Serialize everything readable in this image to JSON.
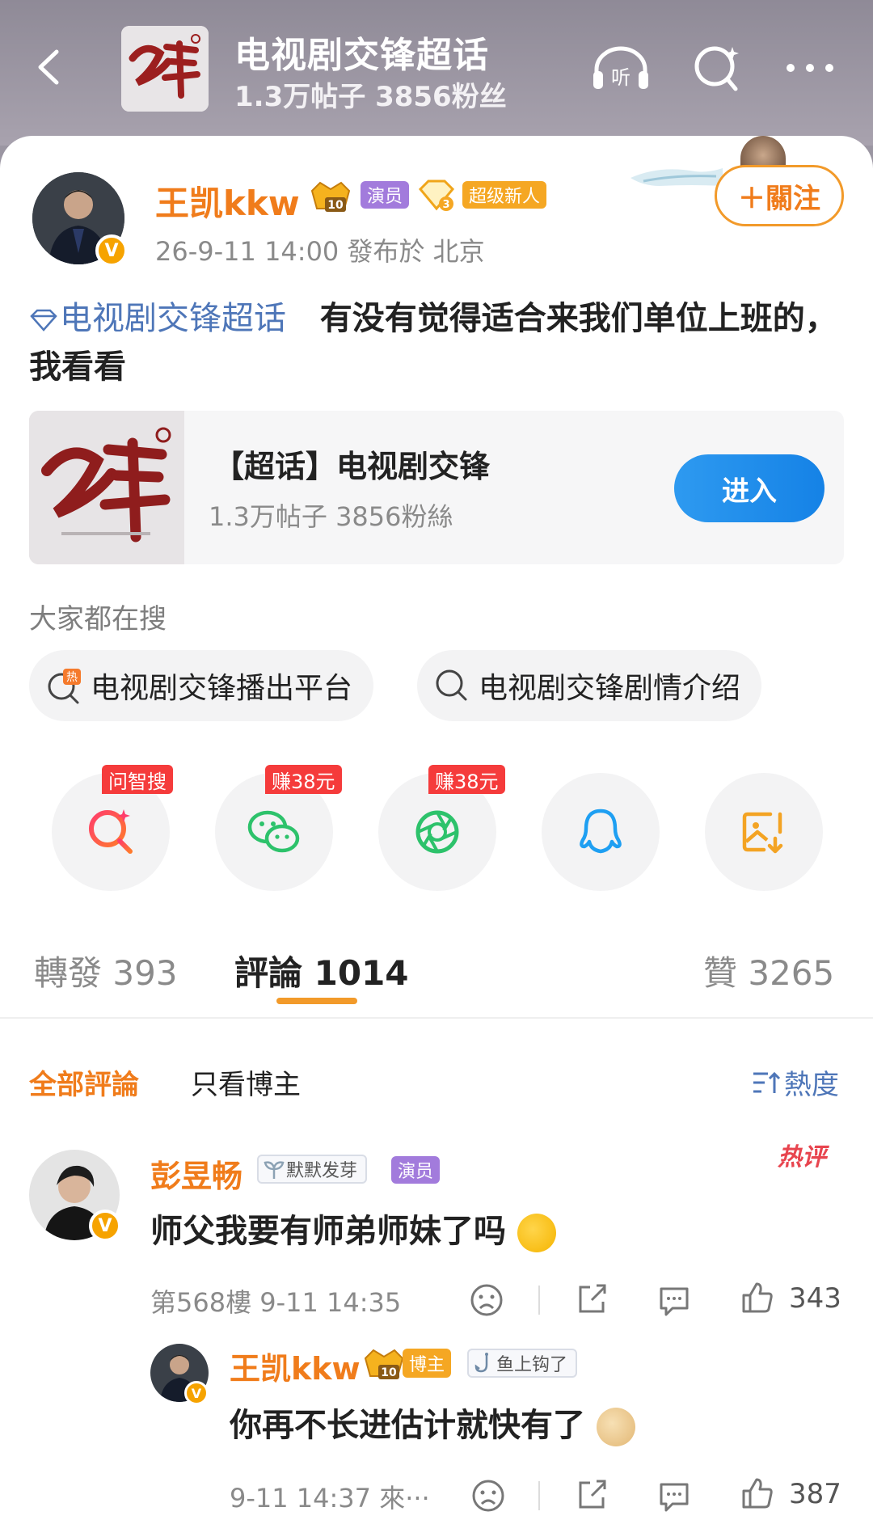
{
  "header": {
    "topic_title": "电视剧交锋超话",
    "topic_stats": "1.3万帖子 3856粉丝",
    "thumb_text": "交锋"
  },
  "post": {
    "author": "王凯kkw",
    "level": "10",
    "actor_tag": "演员",
    "fan_level": "3",
    "new_tag": "超级新人",
    "time": "26-9-11 14:00  發布於 北京",
    "follow_label": "＋關注",
    "topic_link": "电视剧交锋超话",
    "text_body": "有没有觉得适合来我们单位上班的，我看看"
  },
  "topic_card": {
    "title": "【超话】电视剧交锋",
    "stats": "1.3万帖子 3856粉絲",
    "enter_label": "进入",
    "thumb_text": "交锋"
  },
  "searches": {
    "heading": "大家都在搜",
    "chips": [
      "电视剧交锋播出平台",
      "电视剧交锋剧情介绍"
    ]
  },
  "share": {
    "badges": [
      "问智搜",
      "赚38元",
      "赚38元"
    ],
    "icons": [
      "ai-search-icon",
      "wechat-icon",
      "moments-icon",
      "qq-icon",
      "save-image-icon"
    ]
  },
  "tabs": {
    "repost": "轉發 393",
    "comment": "評論 1014",
    "like": "贊 3265"
  },
  "filter": {
    "all": "全部評論",
    "owner_only": "只看博主",
    "sort": "熱度"
  },
  "comments": [
    {
      "name": "彭昱畅",
      "medal": "默默发芽",
      "role_tag": "演员",
      "hot_label": "热评",
      "text": "师父我要有师弟师妹了吗",
      "meta": "第568樓 9-11 14:35",
      "likes": "343"
    },
    {
      "name": "王凯kkw",
      "level": "10",
      "owner_tag": "博主",
      "medal": "鱼上钩了",
      "text": "你再不长进估计就快有了",
      "meta": "9-11 14:37 來···",
      "likes": "387"
    }
  ],
  "colors": {
    "accent_orange": "#f07c1b",
    "link_blue": "#4e76b8",
    "enter_blue": "#1582e6",
    "badge_red": "#f53b3b"
  }
}
